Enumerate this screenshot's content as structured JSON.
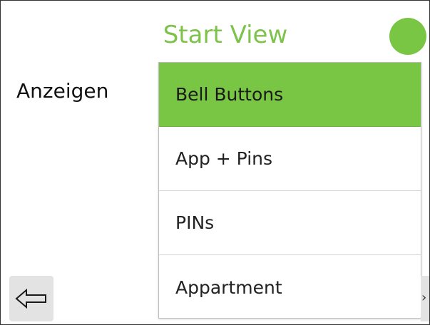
{
  "header": {
    "title": "Start View",
    "status_color": "#79c644"
  },
  "form": {
    "label": "Anzeigen",
    "dropdown": {
      "options": [
        {
          "label": "Bell Buttons",
          "selected": true
        },
        {
          "label": "App + Pins",
          "selected": false
        },
        {
          "label": "PINs",
          "selected": false
        },
        {
          "label": "Appartment",
          "selected": false
        }
      ]
    }
  },
  "navigation": {
    "back_icon": "arrow-left-icon",
    "next_glyph": "›"
  },
  "colors": {
    "accent": "#79c644",
    "title": "#7dc24b",
    "button_bg": "#e3e3e3"
  }
}
